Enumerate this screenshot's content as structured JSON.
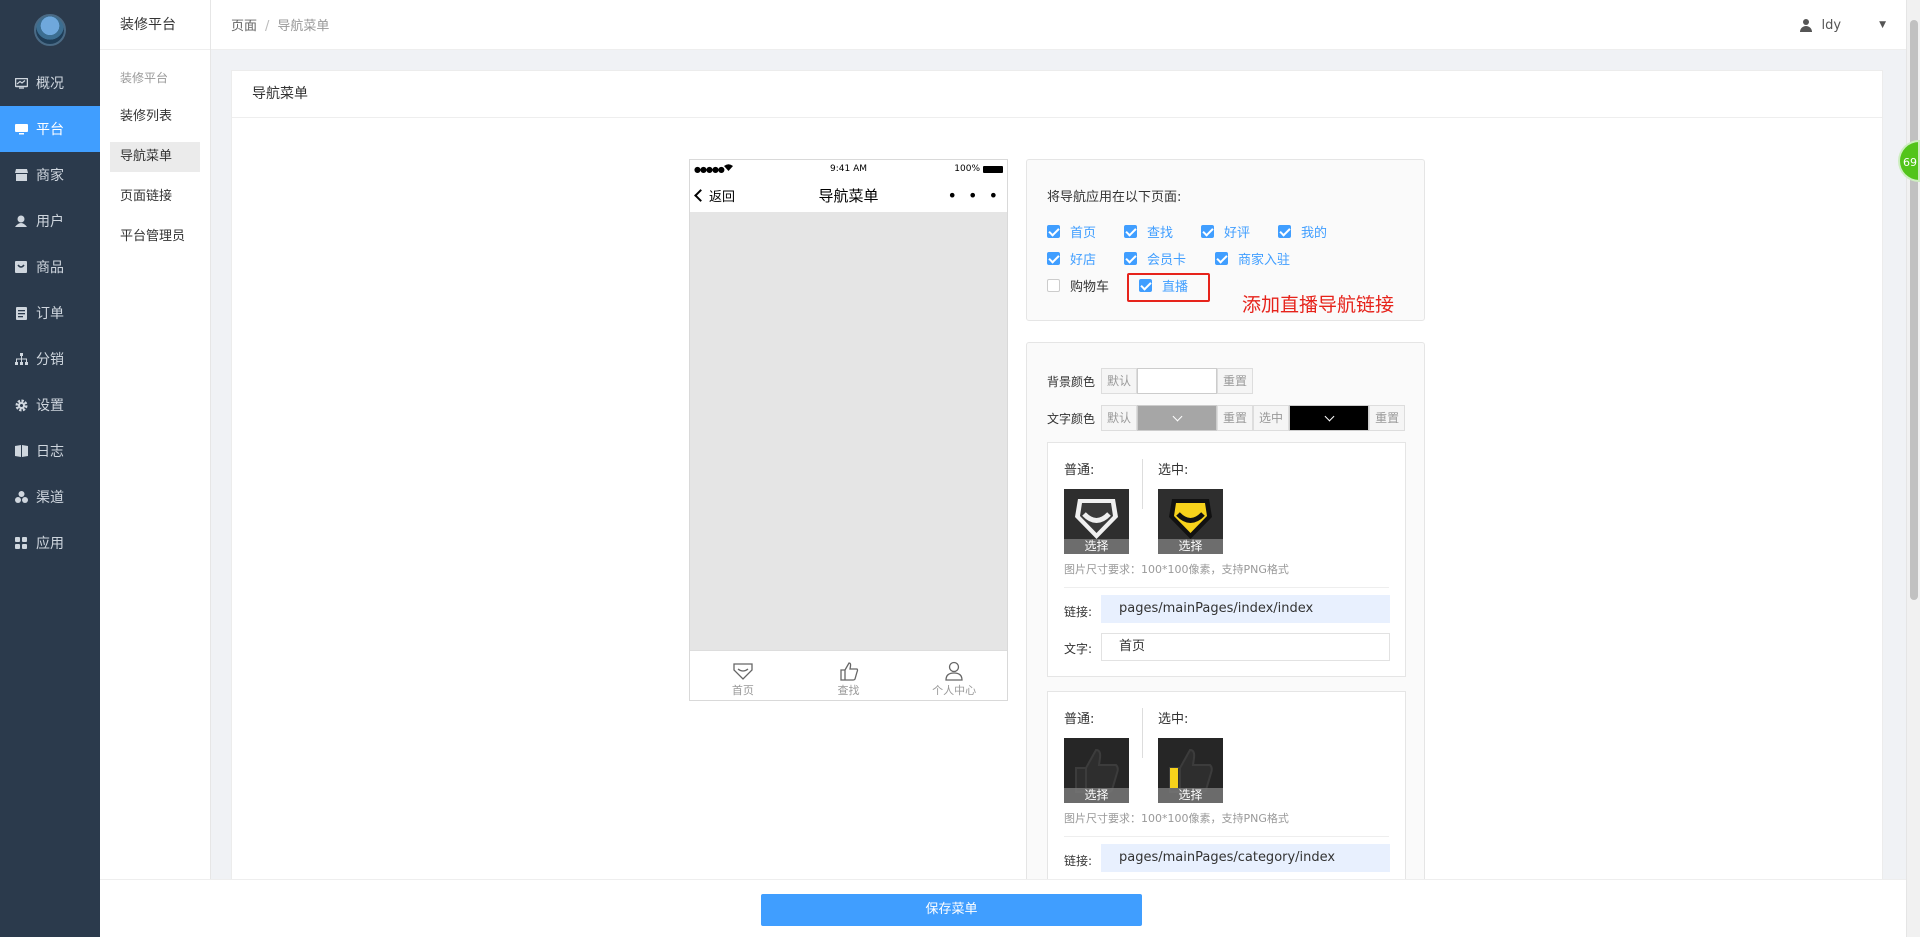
{
  "sidebar": {
    "items": [
      {
        "label": "概况",
        "icon": "dashboard-icon"
      },
      {
        "label": "平台",
        "icon": "monitor-icon"
      },
      {
        "label": "商家",
        "icon": "store-icon"
      },
      {
        "label": "用户",
        "icon": "user-icon"
      },
      {
        "label": "商品",
        "icon": "product-icon"
      },
      {
        "label": "订单",
        "icon": "order-icon"
      },
      {
        "label": "分销",
        "icon": "distribution-icon"
      },
      {
        "label": "设置",
        "icon": "gear-icon"
      },
      {
        "label": "日志",
        "icon": "log-icon"
      },
      {
        "label": "渠道",
        "icon": "channel-icon"
      },
      {
        "label": "应用",
        "icon": "apps-icon"
      }
    ],
    "active_index": 1
  },
  "subsidebar": {
    "title": "装修平台",
    "group": "装修平台",
    "items": [
      "装修列表",
      "导航菜单",
      "页面链接",
      "平台管理员"
    ],
    "active_index": 1
  },
  "breadcrumb": {
    "root": "页面",
    "sep": "/",
    "current": "导航菜单"
  },
  "user": {
    "name": "ldy"
  },
  "scroll_badge": "69",
  "card": {
    "title": "导航菜单"
  },
  "phone": {
    "signal": "●●●●● ",
    "time": "9:41 AM",
    "battery": "100%",
    "back": "返回",
    "title": "导航菜单",
    "dots": "• • •",
    "tabs": [
      "首页",
      "查找",
      "个人中心"
    ]
  },
  "apply": {
    "label": "将导航应用在以下页面:",
    "options": [
      {
        "label": "首页",
        "checked": true
      },
      {
        "label": "查找",
        "checked": true
      },
      {
        "label": "好评",
        "checked": true
      },
      {
        "label": "我的",
        "checked": true
      },
      {
        "label": "好店",
        "checked": true
      },
      {
        "label": "会员卡",
        "checked": true
      },
      {
        "label": "商家入驻",
        "checked": true
      },
      {
        "label": "购物车",
        "checked": false
      },
      {
        "label": "直播",
        "checked": true
      }
    ]
  },
  "annotation": "添加直播导航链接",
  "colors": {
    "bg_label": "背景颜色",
    "text_label": "文字颜色",
    "default": "默认",
    "reset": "重置",
    "selected": "选中",
    "bg_value": "#ffffff",
    "text_normal": "#a6a6a6",
    "text_selected": "#000000",
    "accent": "#409eff",
    "annotation_color": "#e6231b"
  },
  "nav_items": [
    {
      "normal_label": "普通:",
      "selected_label": "选中:",
      "pick": "选择",
      "hint": "图片尺寸要求：100*100像素，支持PNG格式",
      "link_label": "链接:",
      "link": "pages/mainPages/index/index",
      "text_label": "文字:",
      "text": "首页"
    },
    {
      "normal_label": "普通:",
      "selected_label": "选中:",
      "pick": "选择",
      "hint": "图片尺寸要求：100*100像素，支持PNG格式",
      "link_label": "链接:",
      "link": "pages/mainPages/category/index"
    }
  ],
  "footer": {
    "save": "保存菜单"
  }
}
